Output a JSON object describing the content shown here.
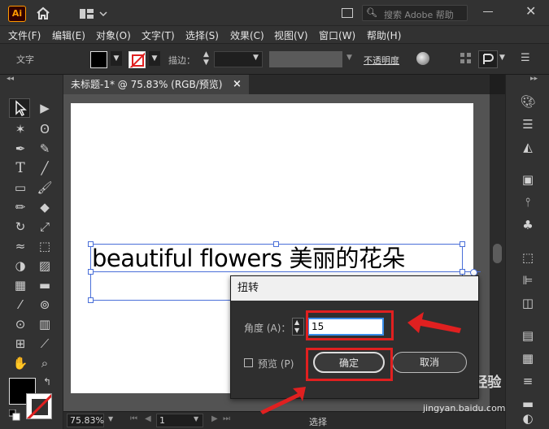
{
  "app": {
    "logo": "Ai"
  },
  "titlebar": {
    "search_placeholder": "搜索 Adobe 帮助"
  },
  "menu": [
    "文件(F)",
    "编辑(E)",
    "对象(O)",
    "文字(T)",
    "选择(S)",
    "效果(C)",
    "视图(V)",
    "窗口(W)",
    "帮助(H)"
  ],
  "control": {
    "mode_label": "文字",
    "stroke_label": "描边：",
    "opacity_label": "不透明度"
  },
  "document": {
    "tab_title": "未标题-1* @ 75.83% (RGB/预览)",
    "close_glyph": "×"
  },
  "artwork": {
    "text": "beautiful flowers 美丽的花朵"
  },
  "dialog": {
    "title": "扭转",
    "angle_label": "角度 (A)：",
    "angle_value": "15",
    "preview_label": "预览 (P)",
    "ok_label": "确定",
    "cancel_label": "取消"
  },
  "status": {
    "zoom": "75.83%",
    "page": "1",
    "tool": "选择"
  },
  "watermark": {
    "text": "Bai du 经验",
    "url": "jingyan.baidu.com"
  },
  "colors": {
    "accent": "#ff9a00",
    "selection": "#4a6fd8",
    "annotation": "#e02020"
  }
}
